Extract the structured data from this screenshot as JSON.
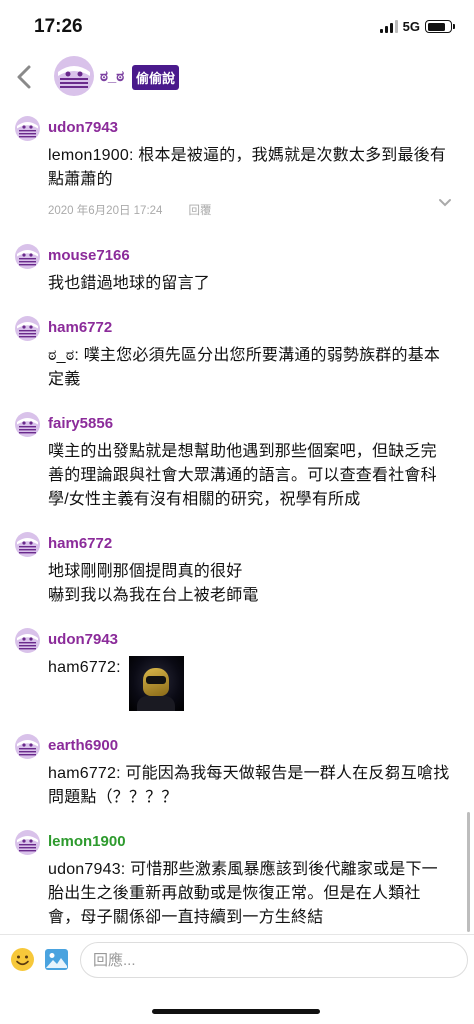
{
  "status_bar": {
    "time": "17:26",
    "network": "5G"
  },
  "header": {
    "name": "ಠ_ಠ",
    "board": "偷偷說"
  },
  "comments": [
    {
      "user": "udon7943",
      "text": "lemon1900: 根本是被逼的，我媽就是次數太多到最後有點蕭蕭的",
      "date": "2020 年6月20日 17:24",
      "reply": "回覆"
    },
    {
      "user": "mouse7166",
      "text": "我也錯過地球的留言了"
    },
    {
      "user": "ham6772",
      "text": "ಠ_ಠ: 噗主您必須先區分出您所要溝通的弱勢族群的基本定義"
    },
    {
      "user": "fairy5856",
      "text": "噗主的出發點就是想幫助他遇到那些個案吧，但缺乏完善的理論跟與社會大眾溝通的語言。可以查查看社會科學/女性主義有沒有相關的研究，祝學有所成"
    },
    {
      "user": "ham6772",
      "text": "地球剛剛那個提問真的很好",
      "text2": "嚇到我以為我在台上被老師電"
    },
    {
      "user": "udon7943",
      "text": "ham6772:"
    },
    {
      "user": "earth6900",
      "text": "ham6772: 可能因為我每天做報告是一群人在反芻互嗆找問題點（？？？？"
    },
    {
      "user": "lemon1900",
      "text": "udon7943: 可惜那些激素風暴應該到後代離家或是下一胎出生之後重新再啟動或是恢復正常。但是在人類社會，母子關係卻一直持續到一方生終結"
    }
  ],
  "reply_bar": {
    "placeholder": "回應..."
  },
  "colors": {
    "username": "#8b2b9a",
    "username_op": "#2d9a2d",
    "badge": "#4a1a8c"
  }
}
